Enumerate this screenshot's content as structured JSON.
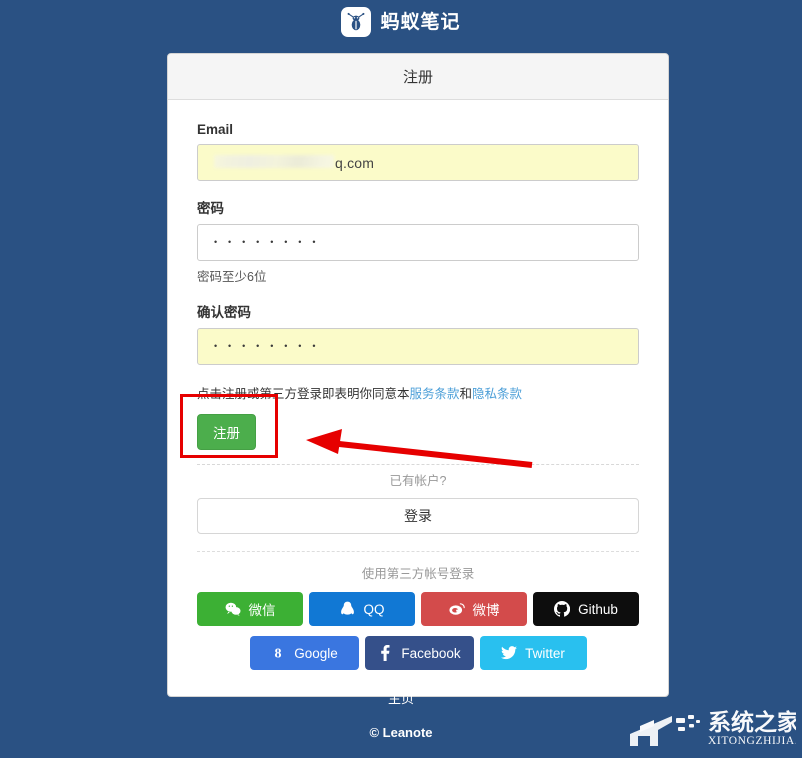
{
  "page": {
    "background_color": "#2a5183",
    "brand_name": "蚂蚁笔记",
    "logo_icon": "ant-logo-icon"
  },
  "card": {
    "title": "注册",
    "fields": {
      "email": {
        "label": "Email",
        "value_tail": "q.com",
        "masked": true,
        "autofilled": true
      },
      "password": {
        "label": "密码",
        "value": "• • • • • • • •",
        "help": "密码至少6位",
        "autofilled": false
      },
      "confirm_password": {
        "label": "确认密码",
        "value": "• • • • • • • •",
        "autofilled": true
      }
    },
    "terms": {
      "prefix": "点击注册或第三方登录即表明你同意本",
      "service_link": "服务条款",
      "middle": "和",
      "privacy_link": "隐私条款"
    },
    "register_button": "注册",
    "have_account_text": "已有帐户?",
    "login_button": "登录",
    "third_party_title": "使用第三方帐号登录",
    "social_buttons": [
      {
        "label": "微信",
        "icon": "wechat-icon",
        "color": "#3cb034"
      },
      {
        "label": "QQ",
        "icon": "qq-icon",
        "color": "#1178d4"
      },
      {
        "label": "微博",
        "icon": "weibo-icon",
        "color": "#d34b4b"
      },
      {
        "label": "Github",
        "icon": "github-icon",
        "color": "#0d0d0d"
      },
      {
        "label": "Google",
        "icon": "google-icon",
        "color": "#3a76e0"
      },
      {
        "label": "Facebook",
        "icon": "facebook-icon",
        "color": "#35508a"
      },
      {
        "label": "Twitter",
        "icon": "twitter-icon",
        "color": "#29c0ef"
      }
    ]
  },
  "footer": {
    "home_link": "主页",
    "copyright": "© Leanote"
  },
  "annotations": {
    "highlight_color": "#e60000",
    "arrow_color": "#e60000",
    "target": "注册"
  },
  "watermark": {
    "name_cn": "系统之家",
    "name_en": "XITONGZHIJIA.NET"
  }
}
